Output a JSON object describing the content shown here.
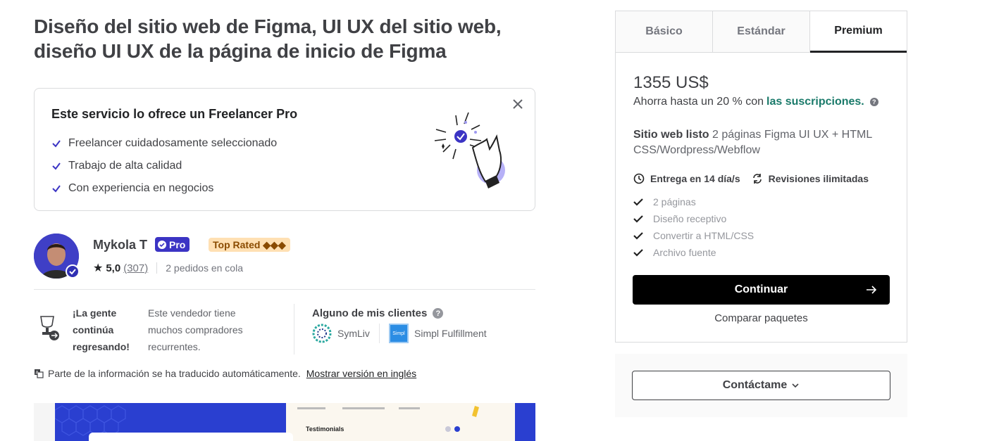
{
  "gig": {
    "title": "Diseño del sitio web de Figma, UI UX del sitio web, diseño UI UX de la página de inicio de Figma"
  },
  "pro_box": {
    "title": "Este servicio lo ofrece un Freelancer Pro",
    "items": [
      "Freelancer cuidadosamente seleccionado",
      "Trabajo de alta calidad",
      "Con experiencia en negocios"
    ]
  },
  "seller": {
    "name": "Mykola T",
    "pro_label": "Pro",
    "top_rated": "Top Rated ◆◆◆",
    "rating": "5,0",
    "reviews": "(307)",
    "queue": "2 pedidos en cola"
  },
  "repeat": {
    "title": "¡La gente continúa regresando!",
    "text": "Este vendedor tiene muchos compradores recurrentes."
  },
  "clients": {
    "title": "Alguno de mis clientes",
    "items": [
      "SymLiv",
      "Simpl Fulfillment"
    ],
    "simpl_logo_text": "Simpl"
  },
  "translate": {
    "note": "Parte de la información se ha traducido automáticamente.",
    "link": "Mostrar versión en inglés"
  },
  "gallery": {
    "testimonials": "Testimonials"
  },
  "package": {
    "tabs": [
      "Básico",
      "Estándar",
      "Premium"
    ],
    "active_tab": "Premium",
    "price": "1355 US$",
    "save_text": "Ahorra hasta un 20 % con",
    "save_link": "las suscripciones.",
    "desc_bold": "Sitio web listo",
    "desc_text": "2 páginas Figma UI UX + HTML CSS/Wordpress/Webflow",
    "delivery": "Entrega en 14 día/s",
    "revisions": "Revisiones ilimitadas",
    "features": [
      "2 páginas",
      "Diseño receptivo",
      "Convertir a HTML/CSS",
      "Archivo fuente"
    ],
    "continue": "Continuar",
    "compare": "Comparar paquetes"
  },
  "contact": {
    "label": "Contáctame"
  },
  "colors": {
    "pro_badge": "#3b34c4",
    "top_rated_bg": "#ffe0b3",
    "link_green": "#1a7a6a",
    "button_black": "#000000"
  }
}
